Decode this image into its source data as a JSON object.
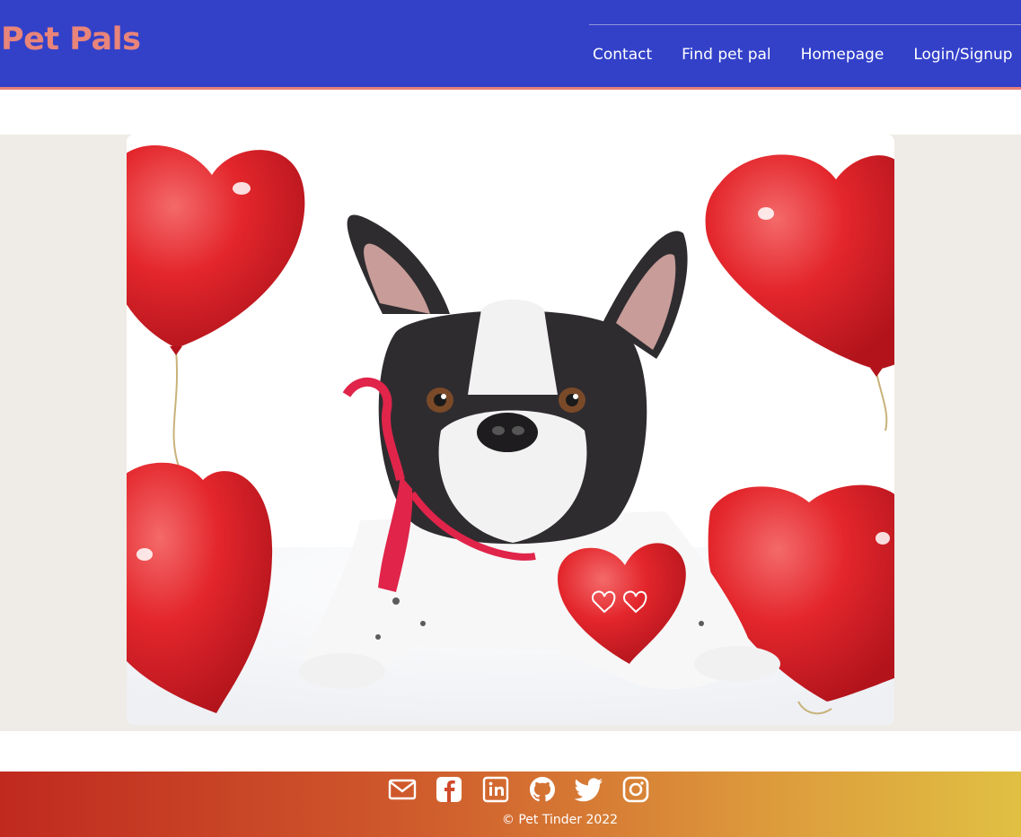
{
  "header": {
    "brand": "Pet Pals",
    "nav": [
      {
        "label": "Contact"
      },
      {
        "label": "Find pet pal"
      },
      {
        "label": "Homepage"
      },
      {
        "label": "Login/Signup"
      }
    ]
  },
  "hero": {
    "image_subject": "French bulldog with red heart balloons"
  },
  "footer": {
    "social_icons": [
      "mail-icon",
      "facebook-icon",
      "linkedin-icon",
      "github-icon",
      "twitter-icon",
      "instagram-icon"
    ],
    "copyright": "© Pet Tinder 2022"
  },
  "colors": {
    "header_bg": "#3341c9",
    "brand": "#e8847a",
    "accent_line": "#e8807a",
    "hero_band": "#efebe6",
    "footer_start": "#c0291f",
    "footer_end": "#e0c043"
  }
}
